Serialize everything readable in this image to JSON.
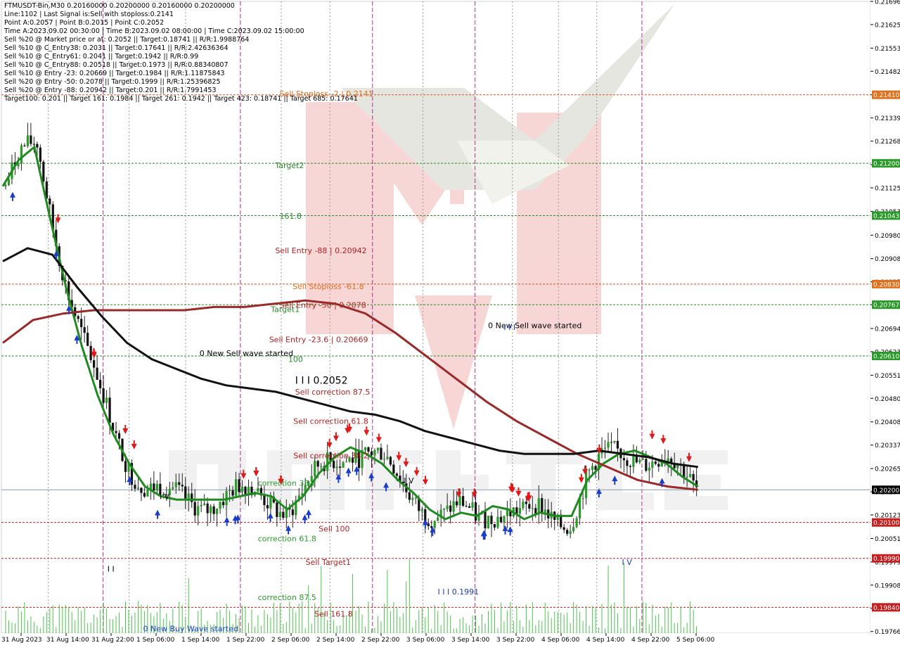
{
  "info": {
    "lines": [
      "FTMUSDT-Bin,M30  0.20160000 0.20200000 0.20160000 0.20200000",
      "Line:1102 | Last Signal is:Sell with stoploss:0.2141",
      "Point A:0.2057 | Point B:0.2015 | Point C:0.2052",
      "Time A:2023.09.02 00:30:00 | Time B:2023.09.02 08:00:00 | Time C:2023.09.02 15:00:00",
      "Sell %20 @ Market price or at: 0.2052 || Target:0.18741 || R/R:1.9988764",
      "Sell %10 @ C_Entry38: 0.2031 || Target:0.17641 || R/R:2.42636364",
      "Sell %10 @ C_Entry61: 0.2041 || Target:0.1942 || R/R:0.99",
      "Sell %10 @ C_Entry88: 0.20518 || Target:0.1973 || R/R:0.88340807",
      "Sell %10 @ Entry -23: 0.20669 || Target:0.1984 || R/R:1.11875843",
      "Sell %20 @ Entry -50: 0.2078 || Target:0.1999 || R/R:1.25396825",
      "Sell %20 @ Entry -88: 0.20942 || Target:0.201 || R/R:1.7991453",
      "Target100: 0.201 || Target 161: 0.1984 || Target 261: 0.1942 || Target 423: 0.18741 || Target 685: 0.17641"
    ]
  },
  "chart_data": {
    "type": "candlestick",
    "symbol": "FTMUSDT-Bin,M30",
    "ylim": [
      0.19761,
      0.21696
    ],
    "x_tick_labels": [
      "31 Aug 2023",
      "31 Aug 14:00",
      "31 Aug 22:00",
      "1 Sep 06:00",
      "1 Sep 14:00",
      "1 Sep 22:00",
      "2 Sep 06:00",
      "2 Sep 14:00",
      "2 Sep 22:00",
      "3 Sep 06:00",
      "3 Sep 14:00",
      "3 Sep 22:00",
      "4 Sep 06:00",
      "4 Sep 14:00",
      "4 Sep 22:00",
      "5 Sep 06:00"
    ],
    "y_tick_labels": [
      "0.21696",
      "0.21625",
      "0.21553",
      "0.21482",
      "0.21410",
      "0.21339",
      "0.21268",
      "0.21196",
      "0.21125",
      "0.21053",
      "0.20980",
      "0.20908",
      "0.20837",
      "0.20767",
      "0.20694",
      "0.20623",
      "0.20551",
      "0.20480",
      "0.20408",
      "0.20337",
      "0.20265",
      "0.20194",
      "0.20123",
      "0.20051",
      "0.19979",
      "0.19908",
      "0.19837",
      "0.19766"
    ],
    "levels": [
      {
        "value": 0.2141,
        "label": "0.21410",
        "color": "#e0701c",
        "line": "#d05020"
      },
      {
        "value": 0.212,
        "label": "0.21200",
        "color": "#2a9a2a",
        "line": "#2a8a2a"
      },
      {
        "value": 0.2104,
        "label": "0.21043",
        "color": "#2a9a2a",
        "line": "#2a8a2a"
      },
      {
        "value": 0.2083,
        "label": "0.20830",
        "color": "#e0701c",
        "line": "#d05020"
      },
      {
        "value": 0.20767,
        "label": "0.20767",
        "color": "#2a9a2a",
        "line": "#2a8a2a"
      },
      {
        "value": 0.2061,
        "label": "0.20610",
        "color": "#2a9a2a",
        "line": "#2a8a2a"
      },
      {
        "value": 0.201,
        "label": "0.20100",
        "color": "#c42020",
        "line": "#c42020"
      },
      {
        "value": 0.1999,
        "label": "0.19990",
        "color": "#c42020",
        "line": "#c42020"
      },
      {
        "value": 0.1984,
        "label": "0.19840",
        "color": "#c42020",
        "line": "#c42020"
      }
    ],
    "current_price": {
      "value": 0.202,
      "label": "0.20200"
    },
    "annotations": [
      {
        "text": "Sell Stoploss -2 | 0.2141",
        "price": 0.21405,
        "xfrac": 0.32,
        "color": "#e0701c"
      },
      {
        "text": "Target2",
        "price": 0.21185,
        "xfrac": 0.315,
        "color": "#2a8a2a"
      },
      {
        "text": "161.8",
        "price": 0.2103,
        "xfrac": 0.32,
        "color": "#2a8a2a"
      },
      {
        "text": "Sell Entry -88 | 0.20942",
        "price": 0.20925,
        "xfrac": 0.315,
        "color": "#b22222"
      },
      {
        "text": "Sell Stoploss -61.8",
        "price": 0.20815,
        "xfrac": 0.335,
        "color": "#e0701c"
      },
      {
        "text": "Target1",
        "price": 0.20745,
        "xfrac": 0.31,
        "color": "#2a8a2a"
      },
      {
        "text": "Sell Entry -50 | 0.2078",
        "price": 0.20758,
        "xfrac": 0.32,
        "color": "#b22222"
      },
      {
        "text": "Sell Entry -23.6 | 0.20669",
        "price": 0.20652,
        "xfrac": 0.308,
        "color": "#b22222"
      },
      {
        "text": "100",
        "price": 0.20592,
        "xfrac": 0.33,
        "color": "#2a8a2a"
      },
      {
        "text": "0 New Sell wave started",
        "price": 0.2061,
        "xfrac": 0.228,
        "color": "#000000"
      },
      {
        "text": "0 New Sell wave started",
        "price": 0.20695,
        "xfrac": 0.56,
        "color": "#000000"
      },
      {
        "text": "I I I 0.2052",
        "price": 0.20525,
        "xfrac": 0.338,
        "color": "#000000"
      },
      {
        "text": "Sell correction 87.5",
        "price": 0.20492,
        "xfrac": 0.338,
        "color": "#b22222"
      },
      {
        "text": "Sell correction 61.8",
        "price": 0.20402,
        "xfrac": 0.336,
        "color": "#b22222"
      },
      {
        "text": "Sell correction 38.2",
        "price": 0.20297,
        "xfrac": 0.336,
        "color": "#b22222"
      },
      {
        "text": "correction 38.2",
        "price": 0.20212,
        "xfrac": 0.295,
        "color": "#2a9a2a"
      },
      {
        "text": "Sell 100",
        "price": 0.20072,
        "xfrac": 0.365,
        "color": "#b22222"
      },
      {
        "text": "correction 61.8",
        "price": 0.20042,
        "xfrac": 0.295,
        "color": "#2a9a2a"
      },
      {
        "text": "Sell Target1",
        "price": 0.1997,
        "xfrac": 0.35,
        "color": "#b22222"
      },
      {
        "text": "correction 87.5",
        "price": 0.19862,
        "xfrac": 0.295,
        "color": "#2a9a2a"
      },
      {
        "text": "Sell 161.8",
        "price": 0.19812,
        "xfrac": 0.36,
        "color": "#b22222"
      },
      {
        "text": "0 New Buy Wave started",
        "price": 0.19766,
        "xfrac": 0.163,
        "color": "#1a3cc8"
      },
      {
        "text": "I I I 0.1991",
        "price": 0.1988,
        "xfrac": 0.502,
        "color": "#1a3cc8"
      },
      {
        "text": "I V",
        "price": 0.2022,
        "xfrac": 0.463,
        "color": "#000000"
      },
      {
        "text": "I V",
        "price": 0.20172,
        "xfrac": 0.182,
        "color": "#000000"
      },
      {
        "text": "I V",
        "price": 0.1997,
        "xfrac": 0.714,
        "color": "#1a3cc8"
      },
      {
        "text": "I I I",
        "price": 0.2069,
        "xfrac": 0.578,
        "color": "#1a3cc8"
      },
      {
        "text": "I I",
        "price": 0.1995,
        "xfrac": 0.122,
        "color": "#000000"
      }
    ],
    "series": [
      {
        "name": "ema-fast",
        "color": "#1f8a1f",
        "values": [
          0.2113,
          0.2121,
          0.2125,
          0.2103,
          0.2082,
          0.2064,
          0.2049,
          0.2037,
          0.2028,
          0.2021,
          0.2018,
          0.2017,
          0.2017,
          0.2017,
          0.2017,
          0.2018,
          0.2019,
          0.2018,
          0.2014,
          0.2018,
          0.2025,
          0.203,
          0.2033,
          0.2031,
          0.2028,
          0.2023,
          0.2019,
          0.2014,
          0.2011,
          0.2013,
          0.2012,
          0.2015,
          0.2014,
          0.2011,
          0.2013,
          0.2012,
          0.2012,
          0.2023,
          0.2028,
          0.2031,
          0.2032,
          0.203,
          0.2028,
          0.2024,
          0.2021
        ]
      },
      {
        "name": "ema-mid",
        "color": "#9a2a2a",
        "values": [
          0.2065,
          0.2072,
          0.2074,
          0.2075,
          0.2075,
          0.2075,
          0.2075,
          0.2076,
          0.2076,
          0.2077,
          0.2078,
          0.2077,
          0.2074,
          0.2068,
          0.2061,
          0.2054,
          0.2047,
          0.2041,
          0.2036,
          0.2031,
          0.2027,
          0.2023,
          0.2021,
          0.202
        ]
      },
      {
        "name": "ema-slow",
        "color": "#111111",
        "values": [
          0.209,
          0.2094,
          0.2092,
          0.2082,
          0.2073,
          0.2065,
          0.206,
          0.2057,
          0.2054,
          0.2052,
          0.2051,
          0.205,
          0.2048,
          0.2046,
          0.2044,
          0.2043,
          0.2041,
          0.2038,
          0.2036,
          0.2034,
          0.2032,
          0.2031,
          0.2031,
          0.2031,
          0.2032,
          0.2031,
          0.203,
          0.2028,
          0.2027
        ]
      }
    ]
  }
}
